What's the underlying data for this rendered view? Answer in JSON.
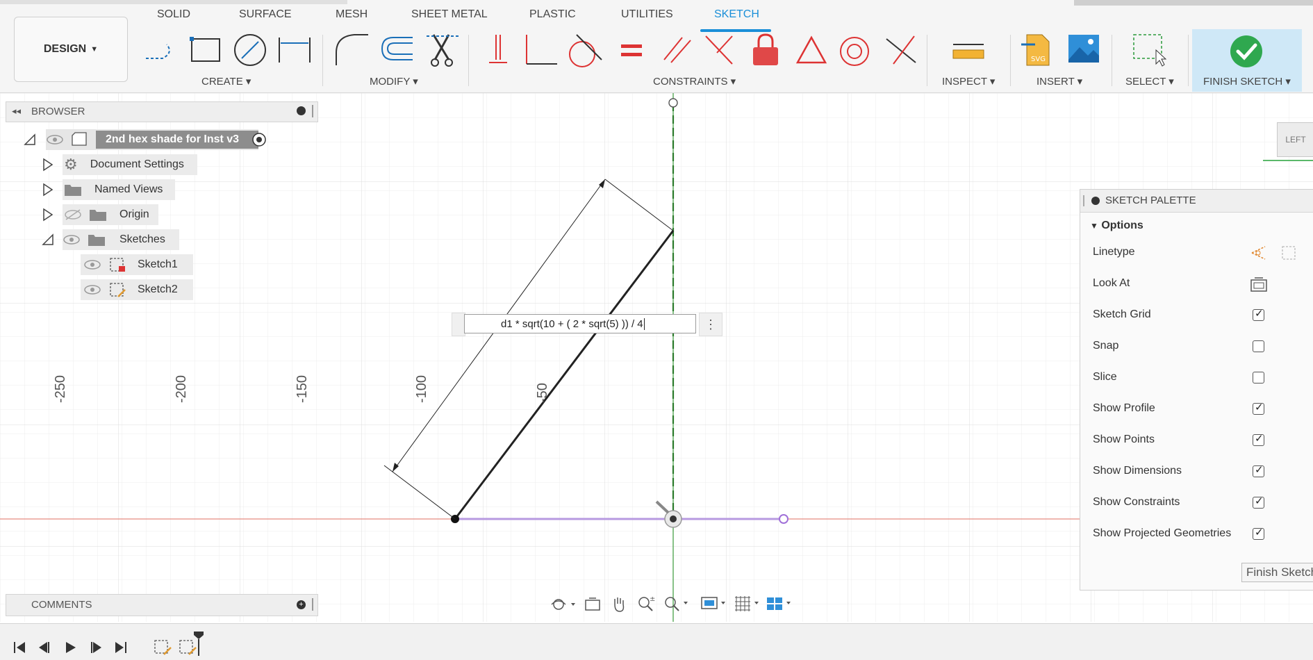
{
  "tabs": [
    "SOLID",
    "SURFACE",
    "MESH",
    "SHEET METAL",
    "PLASTIC",
    "UTILITIES",
    "SKETCH"
  ],
  "workspace": "DESIGN",
  "groups": {
    "create": "CREATE",
    "modify": "MODIFY",
    "constraints": "CONSTRAINTS",
    "inspect": "INSPECT",
    "insert": "INSERT",
    "select": "SELECT",
    "finish": "FINISH SKETCH"
  },
  "browser": {
    "title": "BROWSER",
    "root": "2nd hex shade for Inst v3",
    "items": [
      "Document Settings",
      "Named Views",
      "Origin",
      "Sketches"
    ],
    "sketches": [
      "Sketch1",
      "Sketch2"
    ]
  },
  "comments": {
    "title": "COMMENTS"
  },
  "dimension_input": {
    "value": "d1 * sqrt(10 + ( 2 * sqrt(5) )) / 4"
  },
  "axis_labels": [
    "-250",
    "-200",
    "-150",
    "-100",
    "-50"
  ],
  "viewcube": {
    "face": "LEFT"
  },
  "palette": {
    "title": "SKETCH PALETTE",
    "section": "Options",
    "rows": [
      {
        "label": "Linetype",
        "kind": "icons"
      },
      {
        "label": "Look At",
        "kind": "icon"
      },
      {
        "label": "Sketch Grid",
        "kind": "check",
        "checked": true
      },
      {
        "label": "Snap",
        "kind": "check",
        "checked": false
      },
      {
        "label": "Slice",
        "kind": "check",
        "checked": false
      },
      {
        "label": "Show Profile",
        "kind": "check",
        "checked": true
      },
      {
        "label": "Show Points",
        "kind": "check",
        "checked": true
      },
      {
        "label": "Show Dimensions",
        "kind": "check",
        "checked": true
      },
      {
        "label": "Show Constraints",
        "kind": "check",
        "checked": true
      },
      {
        "label": "Show Projected Geometries",
        "kind": "check",
        "checked": true
      }
    ],
    "finish_button": "Finish Sketch"
  },
  "colors": {
    "accent": "#1a8fd8",
    "finish_bg": "#cfe8f7",
    "axis_red": "#e58a80",
    "axis_green": "#3a9a3a"
  }
}
